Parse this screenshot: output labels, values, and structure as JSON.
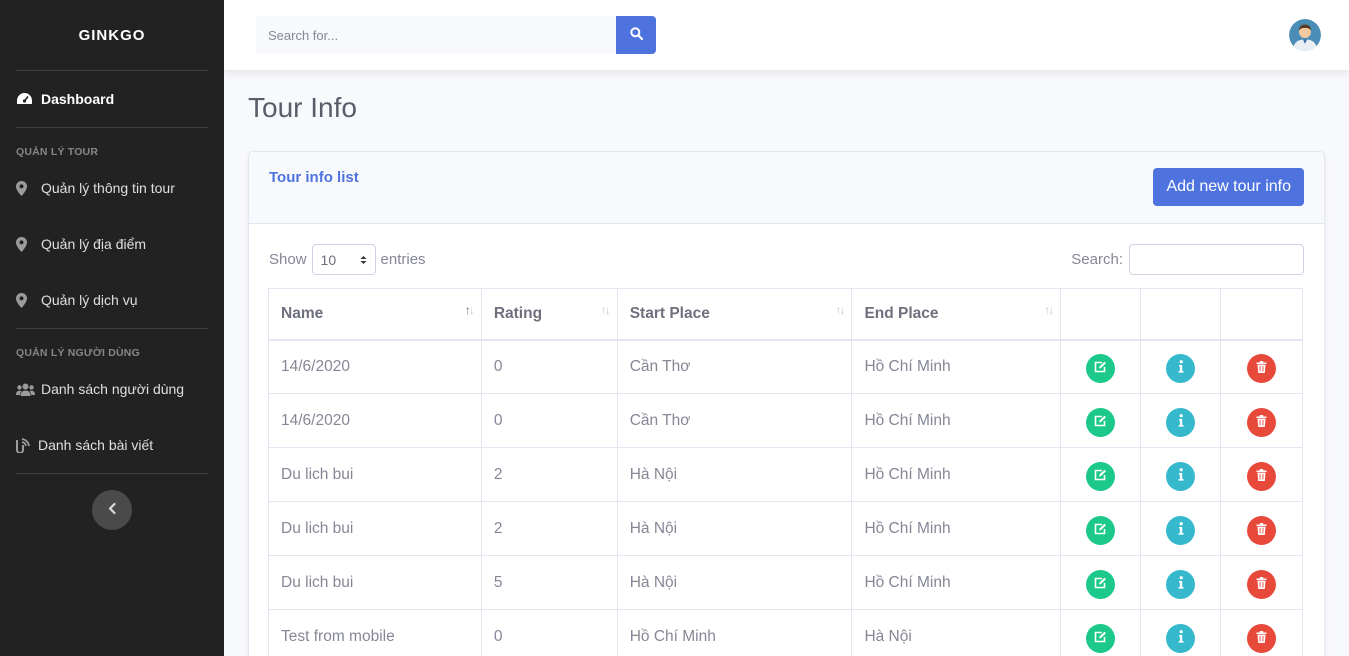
{
  "sidebar": {
    "brand": "GINKGO",
    "dashboard": "Dashboard",
    "section_tour": "QUẢN LÝ TOUR",
    "tour_items": [
      "Quản lý thông tin tour",
      "Quản lý địa điểm",
      "Quản lý dịch vụ"
    ],
    "section_users": "QUẢN LÝ NGƯỜI DÙNG",
    "user_items": [
      "Danh sách người dùng",
      "Danh sách bài viết"
    ]
  },
  "topbar": {
    "search_placeholder": "Search for..."
  },
  "page": {
    "title": "Tour Info"
  },
  "card": {
    "title": "Tour info list",
    "add_button": "Add new tour info"
  },
  "controls": {
    "show_label": "Show",
    "entries_value": "10",
    "entries_label": "entries",
    "search_label": "Search:"
  },
  "table": {
    "headers": [
      "Name",
      "Rating",
      "Start Place",
      "End Place"
    ],
    "rows": [
      {
        "name": "14/6/2020",
        "rating": "0",
        "start": "Cần Thơ",
        "end": "Hồ Chí Minh"
      },
      {
        "name": "14/6/2020",
        "rating": "0",
        "start": "Cần Thơ",
        "end": "Hồ Chí Minh"
      },
      {
        "name": "Du lich bui",
        "rating": "2",
        "start": "Hà Nội",
        "end": "Hồ Chí Minh"
      },
      {
        "name": "Du lich bui",
        "rating": "2",
        "start": "Hà Nội",
        "end": "Hồ Chí Minh"
      },
      {
        "name": "Du lich bui",
        "rating": "5",
        "start": "Hà Nội",
        "end": "Hồ Chí Minh"
      },
      {
        "name": "Test from mobile",
        "rating": "0",
        "start": "Hồ Chí Minh",
        "end": "Hà Nội"
      }
    ]
  },
  "colors": {
    "primary": "#4e73df",
    "success": "#1cc88a",
    "info": "#36b9cc",
    "danger": "#e74a3b",
    "sidebar": "#222222"
  },
  "icons": {
    "dashboard": "tachometer-icon",
    "tour": "map-marker-icon",
    "users": "users-icon",
    "posts": "blog-icon",
    "edit": "edit-icon",
    "info": "info-icon",
    "delete": "trash-icon",
    "search": "search-icon",
    "toggle": "chevron-left-icon"
  }
}
